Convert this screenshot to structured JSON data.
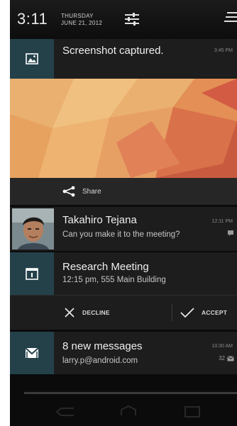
{
  "status": {
    "time": "3:11",
    "day": "THURSDAY",
    "date": "JUNE 21, 2012"
  },
  "notifications": {
    "screenshot": {
      "title": "Screenshot captured.",
      "time": "3:45 PM",
      "icon": "image-icon",
      "share_label": "Share"
    },
    "chat": {
      "sender": "Takahiro Tejana",
      "message": "Can you make it to the meeting?",
      "time": "12:11 PM",
      "icon": "chat-bubble-icon"
    },
    "calendar": {
      "title": "Research Meeting",
      "detail": "12:15 pm, 555 Main Building",
      "icon": "calendar-icon",
      "decline_label": "DECLINE",
      "accept_label": "ACCEPT"
    },
    "mail": {
      "title": "8 new messages",
      "account": "larry.p@android.com",
      "time": "10:30 AM",
      "count": "32",
      "icon": "gmail-icon"
    }
  },
  "colors": {
    "icon_bg": "#24414a",
    "card_bg": "#1d1d1d",
    "shade_bg": "#0b0b0b"
  }
}
